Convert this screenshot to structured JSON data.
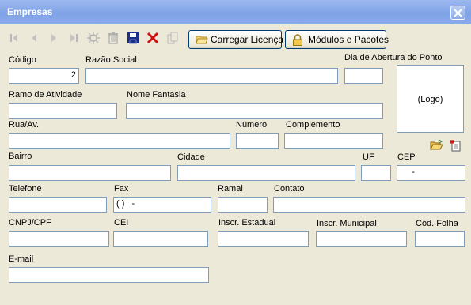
{
  "window": {
    "title": "Empresas"
  },
  "icons": {
    "close": "close-icon",
    "first": "first-record-icon",
    "prev": "previous-record-icon",
    "next": "next-record-icon",
    "last": "last-record-icon",
    "new": "new-record-icon",
    "delete": "delete-icon",
    "save": "save-icon",
    "cancel": "cancel-icon",
    "copy": "copy-icon",
    "folder": "folder-icon",
    "lock": "lock-icon",
    "logo_open": "open-image-icon",
    "logo_new": "new-image-icon"
  },
  "toolbar": {
    "carregar_licenca": "Carregar Licença",
    "modulos_pacotes": "Módulos e Pacotes"
  },
  "form": {
    "codigo": {
      "label": "Código",
      "value": "2"
    },
    "razao_social": {
      "label": "Razão Social",
      "value": ""
    },
    "dia_abertura": {
      "label": "Dia de Abertura do Ponto",
      "value": ""
    },
    "logo": {
      "placeholder": "(Logo)"
    },
    "ramo_atividade": {
      "label": "Ramo de Atividade",
      "value": ""
    },
    "nome_fantasia": {
      "label": "Nome Fantasia",
      "value": ""
    },
    "rua": {
      "label": "Rua/Av.",
      "value": ""
    },
    "numero": {
      "label": "Número",
      "value": ""
    },
    "complemento": {
      "label": "Complemento",
      "value": ""
    },
    "bairro": {
      "label": "Bairro",
      "value": ""
    },
    "cidade": {
      "label": "Cidade",
      "value": ""
    },
    "uf": {
      "label": "UF",
      "value": ""
    },
    "cep": {
      "label": "CEP",
      "value": "     -"
    },
    "telefone": {
      "label": "Telefone",
      "value": ""
    },
    "fax": {
      "label": "Fax",
      "value": "( )   -"
    },
    "ramal": {
      "label": "Ramal",
      "value": ""
    },
    "contato": {
      "label": "Contato",
      "value": ""
    },
    "cnpj_cpf": {
      "label": "CNPJ/CPF",
      "value": ""
    },
    "cei": {
      "label": "CEI",
      "value": ""
    },
    "inscr_estadual": {
      "label": "Inscr. Estadual",
      "value": ""
    },
    "inscr_municipal": {
      "label": "Inscr. Municipal",
      "value": ""
    },
    "cod_folha": {
      "label": "Cód. Folha",
      "value": ""
    },
    "email": {
      "label": "E-mail",
      "value": ""
    }
  }
}
